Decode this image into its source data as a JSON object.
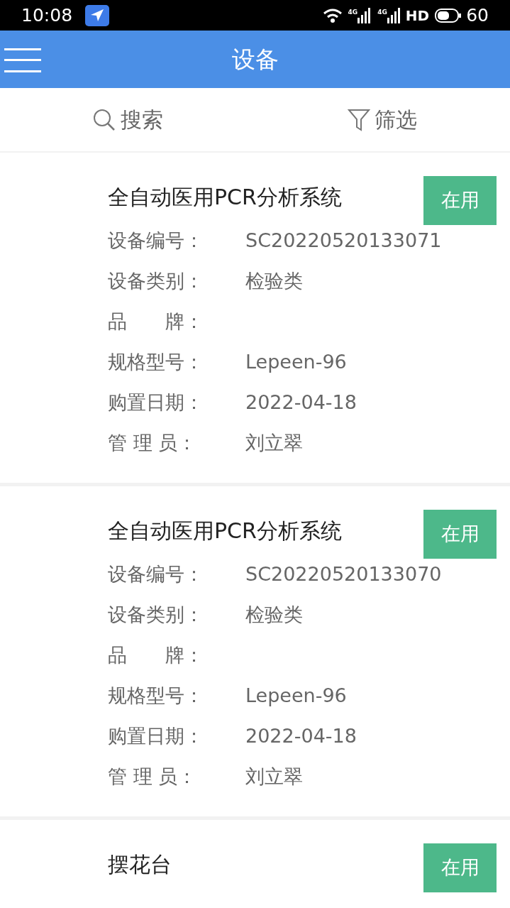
{
  "status_bar": {
    "time": "10:08",
    "signals": [
      "4G",
      "4G"
    ],
    "hd": "HD",
    "battery": "60"
  },
  "header": {
    "title": "设备"
  },
  "toolbar": {
    "search": "搜索",
    "filter": "筛选"
  },
  "devices": [
    {
      "name": "全自动医用PCR分析系统",
      "status": "在用",
      "fields": [
        {
          "label": "设备编号：",
          "value": "SC20220520133071"
        },
        {
          "label": "设备类别：",
          "value": "检验类"
        },
        {
          "label": "品　　牌："
        },
        {
          "label": "规格型号：",
          "value": "Lepeen-96"
        },
        {
          "label": "购置日期：",
          "value": "2022-04-18"
        },
        {
          "label": "管 理 员：",
          "value": "刘立翠"
        }
      ]
    },
    {
      "name": "全自动医用PCR分析系统",
      "status": "在用",
      "fields": [
        {
          "label": "设备编号：",
          "value": "SC20220520133070"
        },
        {
          "label": "设备类别：",
          "value": "检验类"
        },
        {
          "label": "品　　牌："
        },
        {
          "label": "规格型号：",
          "value": "Lepeen-96"
        },
        {
          "label": "购置日期：",
          "value": "2022-04-18"
        },
        {
          "label": "管 理 员：",
          "value": "刘立翠"
        }
      ]
    },
    {
      "name": "摆花台",
      "status": "在用"
    }
  ]
}
